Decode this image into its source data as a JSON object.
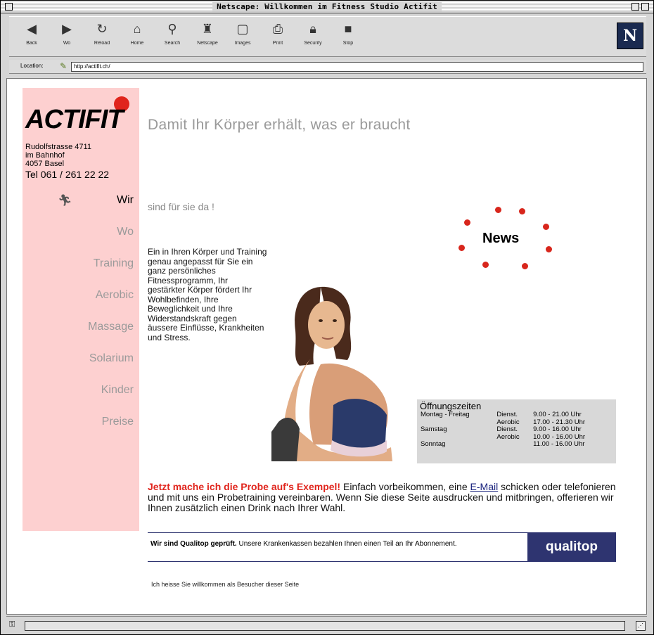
{
  "window": {
    "title": "Netscape: Willkommen im Fitness Studio Actifit"
  },
  "toolbar": {
    "buttons": [
      {
        "label": "Back",
        "icon": "back-arrow-icon"
      },
      {
        "label": "Wo",
        "icon": "forward-arrow-icon"
      },
      {
        "label": "Reload",
        "icon": "reload-icon"
      },
      {
        "label": "Home",
        "icon": "home-icon"
      },
      {
        "label": "Search",
        "icon": "search-icon"
      },
      {
        "label": "Netscape",
        "icon": "netscape-icon"
      },
      {
        "label": "Images",
        "icon": "images-icon"
      },
      {
        "label": "Print",
        "icon": "print-icon"
      },
      {
        "label": "Security",
        "icon": "lock-icon"
      },
      {
        "label": "Stop",
        "icon": "stop-icon"
      }
    ]
  },
  "location": {
    "label": "Location:",
    "value": "http://actifit.ch/"
  },
  "brand": {
    "name": "ACTIFIT",
    "address_lines": [
      "Rudolfstrasse 4711",
      "im Bahnhof",
      "4057 Basel"
    ],
    "tel": "Tel 061 / 261 22 22"
  },
  "nav": [
    {
      "label": "Wir",
      "active": true
    },
    {
      "label": "Wo",
      "active": false
    },
    {
      "label": "Training",
      "active": false
    },
    {
      "label": "Aerobic",
      "active": false
    },
    {
      "label": "Massage",
      "active": false
    },
    {
      "label": "Solarium",
      "active": false
    },
    {
      "label": "Kinder",
      "active": false
    },
    {
      "label": "Preise",
      "active": false
    }
  ],
  "headline": "Damit Ihr Körper erhält, was er braucht",
  "subline": "sind für sie da !",
  "bodytext": "Ein in Ihren Körper und Training genau angepasst für Sie ein ganz persönliches Fitnessprogramm, Ihr gestärkter Körper fördert Ihr Wohlbefinden, Ihre Beweglichkeit und Ihre Widerstandskraft gegen äussere Einflüsse, Krankheiten und Stress.",
  "news": {
    "label": "News"
  },
  "hours": {
    "title": "Öffnungszeiten",
    "rows": [
      {
        "day": "Montag - Freitag",
        "label": "Dienst.",
        "time": "9.00 - 21.00 Uhr"
      },
      {
        "day": "",
        "label": "Aerobic",
        "time": "17.00 - 21.30 Uhr"
      },
      {
        "day": "Samstag",
        "label": "Dienst.",
        "time": "9.00 - 16.00 Uhr"
      },
      {
        "day": "",
        "label": "Aerobic",
        "time": "10.00 - 16.00 Uhr"
      },
      {
        "day": "Sonntag",
        "label": "",
        "time": "11.00 - 16.00 Uhr"
      }
    ]
  },
  "offer": {
    "highlight": "Jetzt mache ich die Probe auf's Exempel!",
    "text_before_link": " Einfach vorbeikommen, eine ",
    "link": "E-Mail",
    "text_after_link": " schicken oder telefonieren und mit uns ein Probetraining vereinbaren. Wenn Sie diese Seite ausdrucken und mitbringen, offerieren wir Ihnen zusätzlich einen Drink nach Ihrer Wahl."
  },
  "quality": {
    "bold": "Wir sind Qualitop geprüft.",
    "text": " Unsere Krankenkassen bezahlen Ihnen einen Teil an Ihr Abonnement.",
    "logo": "qualitop"
  },
  "visitor": "Ich heisse Sie willkommen als Besucher dieser Seite",
  "colors": {
    "sidebar": "#fdd0d0",
    "accent_red": "#e0241c",
    "qualitop_blue": "#2e3470"
  }
}
